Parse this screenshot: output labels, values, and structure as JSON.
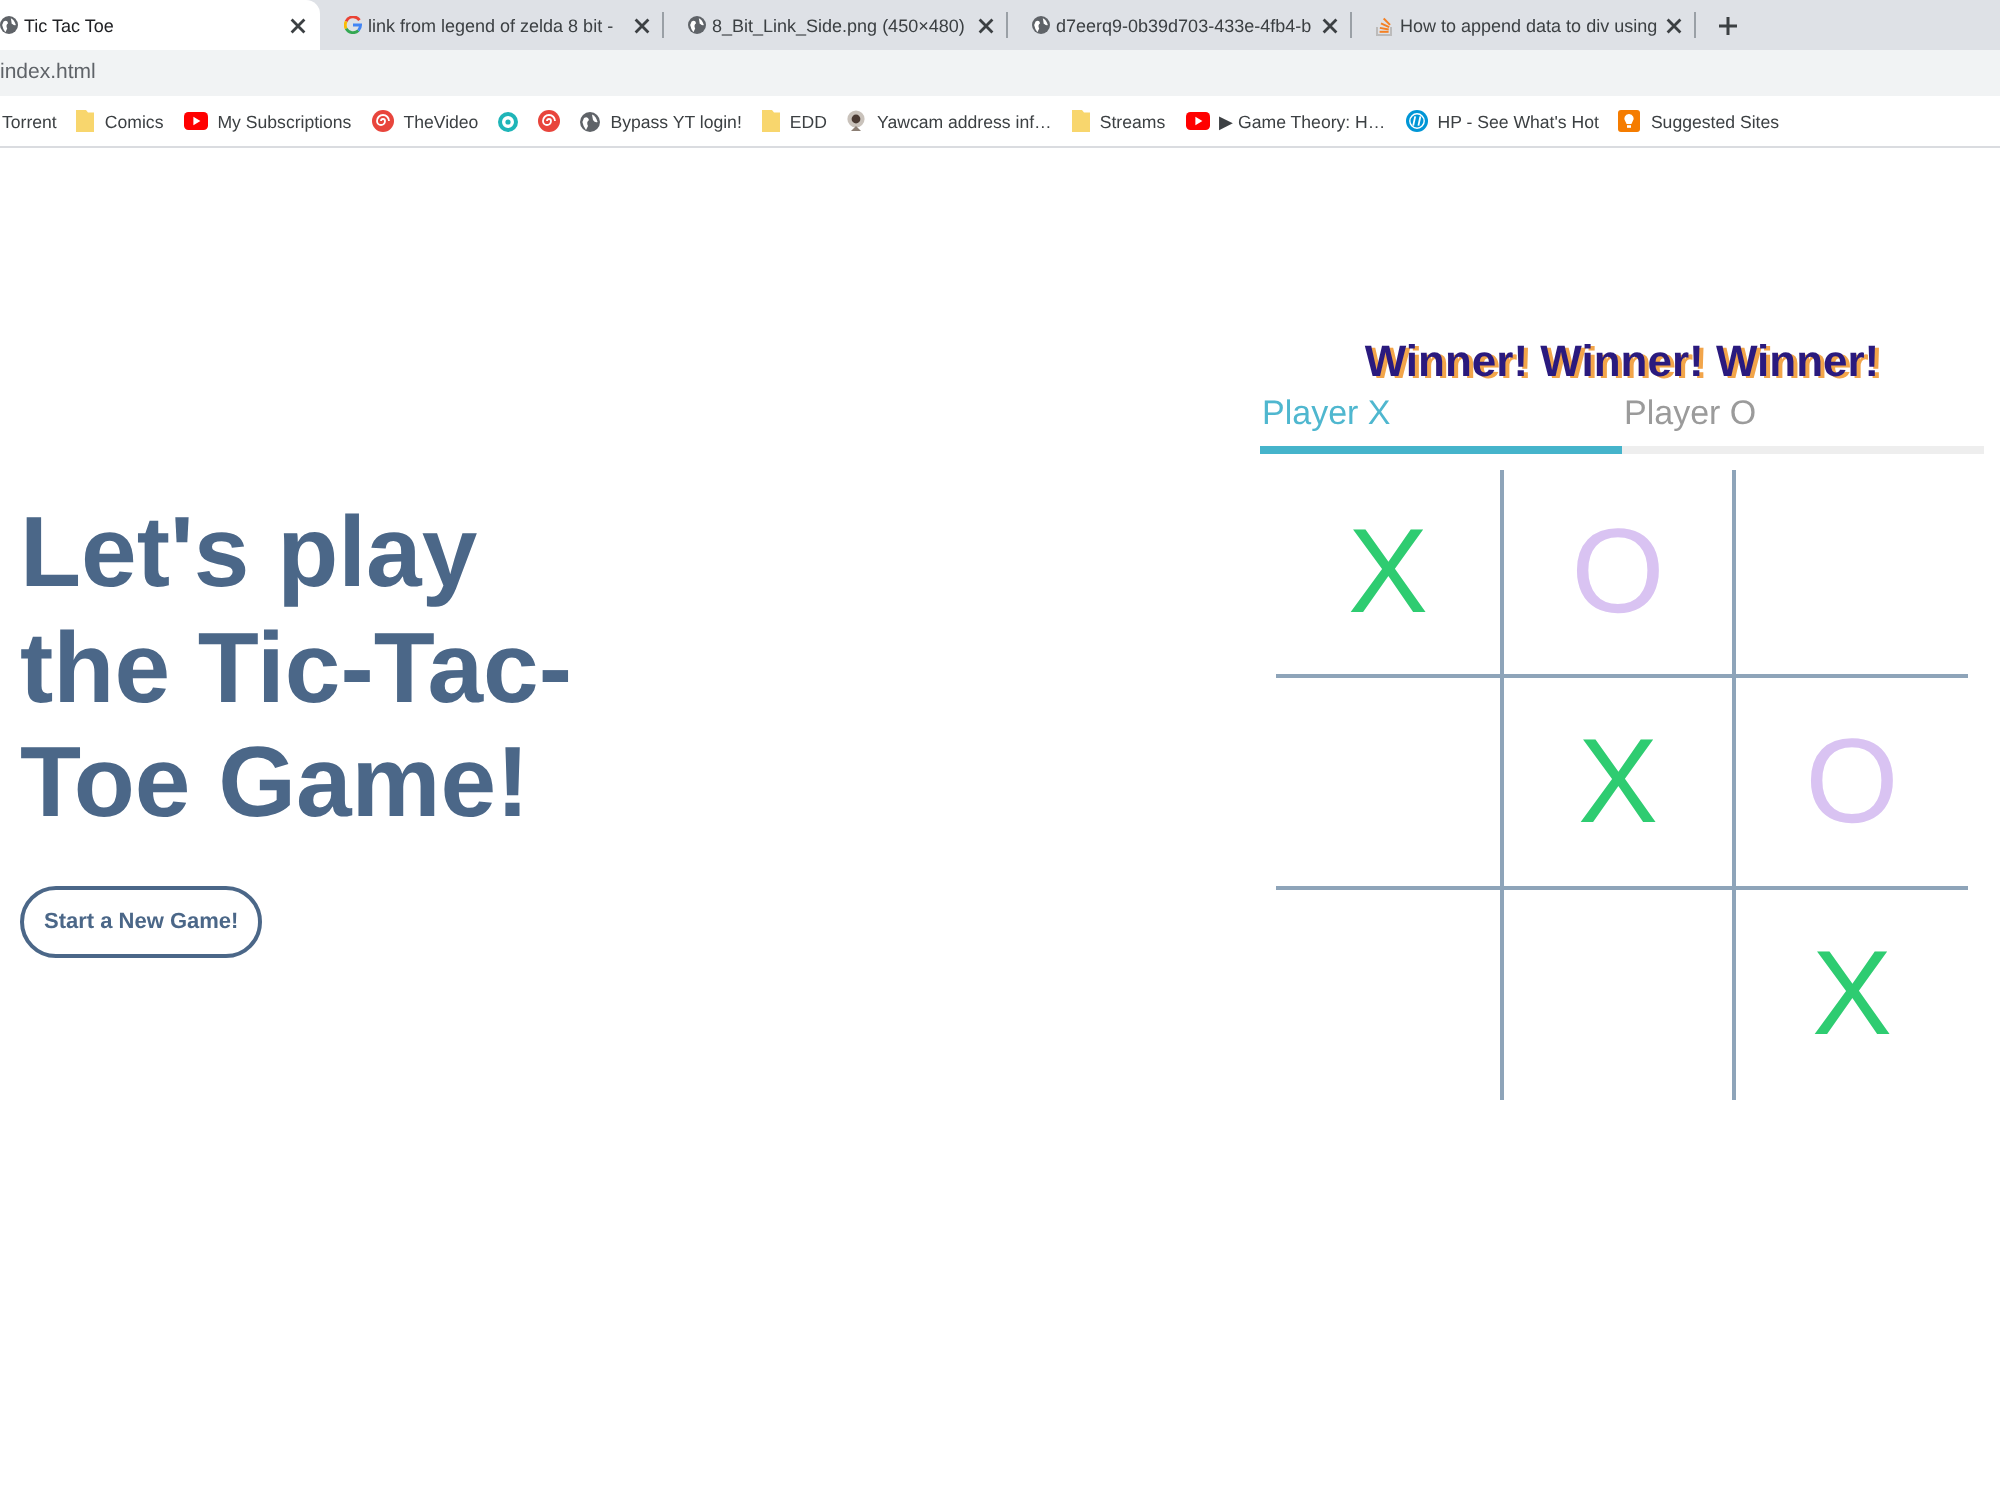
{
  "browser": {
    "tabs": [
      {
        "kind": "globe",
        "title": "Tic Tac Toe",
        "selected": true
      },
      {
        "kind": "google",
        "title": "link from legend of zelda 8 bit -",
        "selected": false
      },
      {
        "kind": "globe",
        "title": "8_Bit_Link_Side.png (450×480)",
        "selected": false
      },
      {
        "kind": "globe",
        "title": "d7eerq9-0b39d703-433e-4fb4-b",
        "selected": false
      },
      {
        "kind": "stack",
        "title": "How to append data to div using",
        "selected": false
      }
    ],
    "address": "index.html",
    "bookmarks": [
      {
        "kind": "none",
        "label": "Torrent"
      },
      {
        "kind": "folder",
        "label": "Comics"
      },
      {
        "kind": "youtube",
        "label": "My Subscriptions"
      },
      {
        "kind": "swirl",
        "label": "TheVideo"
      },
      {
        "kind": "ring"
      },
      {
        "kind": "swirl"
      },
      {
        "kind": "globe",
        "label": "Bypass YT login!"
      },
      {
        "kind": "folder",
        "label": "EDD"
      },
      {
        "kind": "webcam",
        "label": "Yawcam address inf…"
      },
      {
        "kind": "folder",
        "label": "Streams"
      },
      {
        "kind": "youtube",
        "label": "▶ Game Theory: H…"
      },
      {
        "kind": "hp",
        "label": "HP - See What's Hot"
      },
      {
        "kind": "bulb",
        "label": "Suggested Sites"
      }
    ]
  },
  "page": {
    "heading": "Let's play the Tic-Tac-Toe Game!",
    "new_game_button": "Start a New Game!"
  },
  "game": {
    "status": "Winner! Winner! Winner!",
    "players": [
      {
        "label": "Player X",
        "selected": true
      },
      {
        "label": "Player O",
        "selected": false
      }
    ],
    "board": [
      [
        {
          "kind": "x",
          "mark": "X"
        },
        {
          "kind": "o",
          "mark": "O"
        },
        {
          "kind": "empty"
        }
      ],
      [
        {
          "kind": "empty"
        },
        {
          "kind": "x",
          "mark": "X"
        },
        {
          "kind": "o",
          "mark": "O"
        }
      ],
      [
        {
          "kind": "empty"
        },
        {
          "kind": "empty"
        },
        {
          "kind": "x",
          "mark": "X"
        }
      ]
    ]
  }
}
